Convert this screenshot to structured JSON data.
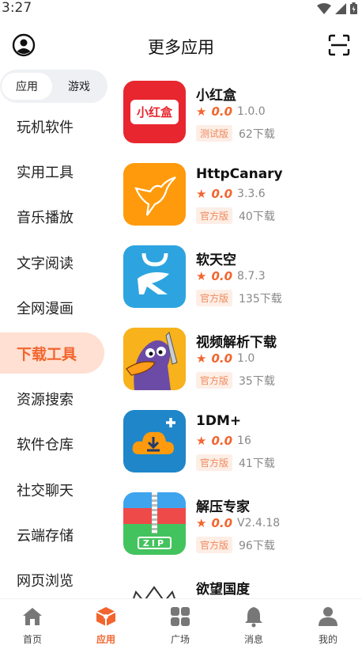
{
  "status_bar": {
    "time": "3:27"
  },
  "header": {
    "title": "更多应用"
  },
  "segment": {
    "options": [
      "应用",
      "游戏"
    ],
    "selected": "应用"
  },
  "sidebar": {
    "items": [
      {
        "label": "玩机软件"
      },
      {
        "label": "实用工具"
      },
      {
        "label": "音乐播放"
      },
      {
        "label": "文字阅读"
      },
      {
        "label": "全网漫画"
      },
      {
        "label": "下载工具",
        "active": true
      },
      {
        "label": "资源搜索"
      },
      {
        "label": "软件仓库"
      },
      {
        "label": "社交聊天"
      },
      {
        "label": "云端存储"
      },
      {
        "label": "网页浏览"
      }
    ]
  },
  "apps": [
    {
      "name": "小红盒",
      "icon_text": "小红盒",
      "score": "0.0",
      "version": "1.0.0",
      "tag": "测试版",
      "downloads": "62下载"
    },
    {
      "name": "HttpCanary",
      "score": "0.0",
      "version": "3.3.6",
      "tag": "官方版",
      "downloads": "40下载"
    },
    {
      "name": "软天空",
      "score": "0.0",
      "version": "8.7.3",
      "tag": "官方版",
      "downloads": "135下载"
    },
    {
      "name": "视频解析下载",
      "score": "0.0",
      "version": "1.0",
      "tag": "官方版",
      "downloads": "35下载"
    },
    {
      "name": "1DM+",
      "score": "0.0",
      "version": "16",
      "tag": "官方版",
      "downloads": "41下载"
    },
    {
      "name": "解压专家",
      "icon_text": "ZIP",
      "score": "0.0",
      "version": "V2.4.18",
      "tag": "官方版",
      "downloads": "96下载"
    },
    {
      "name": "欲望国度"
    }
  ],
  "bottom_nav": {
    "items": [
      {
        "label": "首页",
        "icon": "home-icon"
      },
      {
        "label": "应用",
        "icon": "cube-icon",
        "active": true
      },
      {
        "label": "广场",
        "icon": "grid-icon"
      },
      {
        "label": "消息",
        "icon": "bell-icon"
      },
      {
        "label": "我的",
        "icon": "person-icon"
      }
    ]
  },
  "colors": {
    "accent": "#f2652e",
    "accent_bg": "#ffe0d2",
    "tag_bg": "#fdeee6"
  }
}
